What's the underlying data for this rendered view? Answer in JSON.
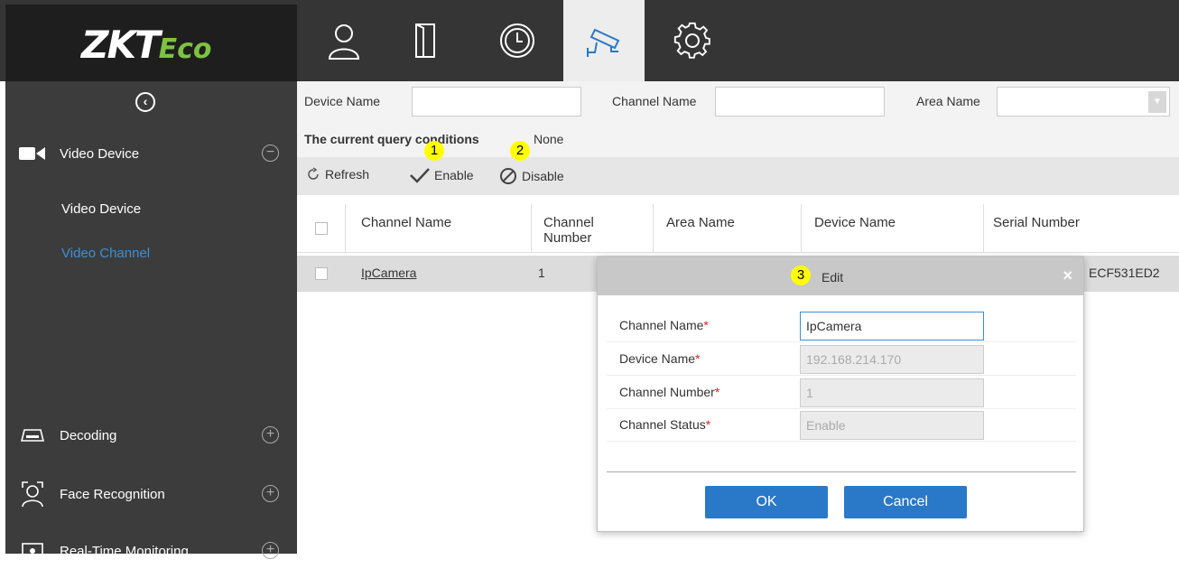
{
  "app": {
    "logo_main": "ZKT",
    "logo_tail": "Eco"
  },
  "topnav": [
    {
      "name": "personnel",
      "icon": "person-icon"
    },
    {
      "name": "access",
      "icon": "door-icon"
    },
    {
      "name": "attendance",
      "icon": "clock-icon"
    },
    {
      "name": "video",
      "icon": "camera-icon",
      "active": true
    },
    {
      "name": "system",
      "icon": "gear-icon"
    }
  ],
  "sidebar": {
    "groups": [
      {
        "label": "Video Device",
        "icon": "video-camera-icon",
        "expanded": true
      },
      {
        "label": "Decoding",
        "icon": "decoder-icon",
        "expanded": false
      },
      {
        "label": "Face Recognition",
        "icon": "face-icon",
        "expanded": false
      },
      {
        "label": "Real-Time Monitoring",
        "icon": "monitor-icon",
        "expanded": false
      }
    ],
    "items": [
      {
        "label": "Video Device",
        "active": false
      },
      {
        "label": "Video Channel",
        "active": true
      }
    ]
  },
  "query": {
    "device_name_label": "Device Name",
    "channel_name_label": "Channel Name",
    "area_name_label": "Area Name",
    "device_name_value": "",
    "channel_name_value": "",
    "area_name_value": ""
  },
  "conditions": {
    "label": "The current query conditions",
    "value": "None"
  },
  "toolbar": {
    "refresh": "Refresh",
    "enable": "Enable",
    "disable": "Disable"
  },
  "badges": {
    "one": "1",
    "two": "2",
    "three": "3"
  },
  "table": {
    "headers": [
      "Channel Name",
      "Channel Number",
      "Area Name",
      "Device Name",
      "Serial Number"
    ],
    "rows": [
      {
        "channel_name": "IpCamera",
        "channel_number": "1",
        "serial_tail": "ECF531ED2"
      }
    ]
  },
  "dialog": {
    "title": "Edit",
    "close": "×",
    "fields": [
      {
        "label": "Channel Name",
        "required": "*",
        "value": "IpCamera",
        "editable": true
      },
      {
        "label": "Device Name",
        "required": "*",
        "value": "192.168.214.170",
        "editable": false
      },
      {
        "label": "Channel Number",
        "required": "*",
        "value": "1",
        "editable": false
      },
      {
        "label": "Channel Status",
        "required": "*",
        "value": "Enable",
        "editable": false
      }
    ],
    "ok": "OK",
    "cancel": "Cancel"
  },
  "colors": {
    "accent": "#2a78c8",
    "sidebar_active": "#3c8fd6",
    "badge": "#ffff00",
    "required": "#e02020"
  }
}
